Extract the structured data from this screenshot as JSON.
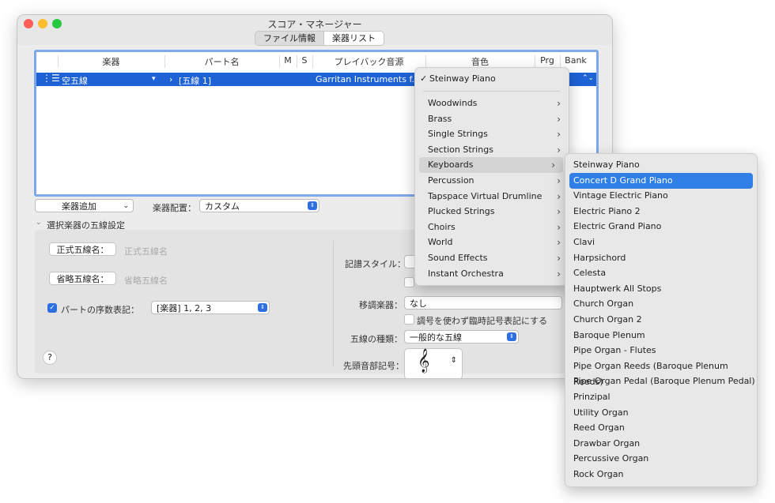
{
  "window": {
    "title": "スコア・マネージャー",
    "tabs": [
      "ファイル情報",
      "楽器リスト"
    ]
  },
  "table": {
    "headers": [
      "楽器",
      "パート名",
      "M",
      "S",
      "プレイバック音源",
      "音色",
      "Prg",
      "Bank"
    ],
    "row": {
      "instrument": "空五線",
      "part_name": "[五線 1]",
      "playback": "Garritan Instruments f..."
    }
  },
  "controls": {
    "add_instrument": "楽器追加",
    "placement_label": "楽器配置：",
    "placement_value": "カスタム",
    "section_title": "選択楽器の五線設定",
    "full_name_button": "正式五線名：",
    "full_name_placeholder": "正式五線名",
    "abbr_name_button": "省略五線名：",
    "abbr_name_placeholder": "省略五線名",
    "part_ordinal_label": "パートの序数表記：",
    "part_ordinal_value": "[楽器] 1, 2, 3",
    "notation_style_label": "記譜スタイル：",
    "transposing_label": "移調楽器：",
    "transposing_value": "なし",
    "key_checkbox_label": "調号を使わず臨時記号表記にする",
    "staff_type_label": "五線の種類：",
    "staff_type_value": "一般的な五線",
    "first_clef_label": "先頭音部記号：",
    "help": "?"
  },
  "sound_menu": {
    "current": "Steinway Piano",
    "checkmark": "✓",
    "items": [
      "Woodwinds",
      "Brass",
      "Single Strings",
      "Section Strings",
      "Keyboards",
      "Percussion",
      "Tapspace Virtual Drumline",
      "Plucked Strings",
      "Choirs",
      "World",
      "Sound Effects",
      "Instant Orchestra"
    ],
    "highlighted": "Keyboards"
  },
  "keyboards_menu": {
    "items": [
      "Steinway Piano",
      "Concert D Grand Piano",
      "Vintage Electric Piano",
      "Electric Piano 2",
      "Electric Grand Piano",
      "Clavi",
      "Harpsichord",
      "Celesta",
      "Hauptwerk All Stops",
      "Church Organ",
      "Church Organ 2",
      "Baroque Plenum",
      "Pipe Organ - Flutes",
      "Pipe Organ Reeds (Baroque Plenum Reeds)",
      "Pipe Organ Pedal (Baroque Plenum Pedal)",
      "Prinzipal",
      "Utility Organ",
      "Reed Organ",
      "Drawbar Organ",
      "Percussive Organ",
      "Rock Organ"
    ],
    "selected": "Concert D Grand Piano"
  },
  "colors": {
    "selection_blue": "#1e63d6",
    "menu_selection": "#2f7fe6",
    "table_focus_ring": "#7fa8ea"
  }
}
